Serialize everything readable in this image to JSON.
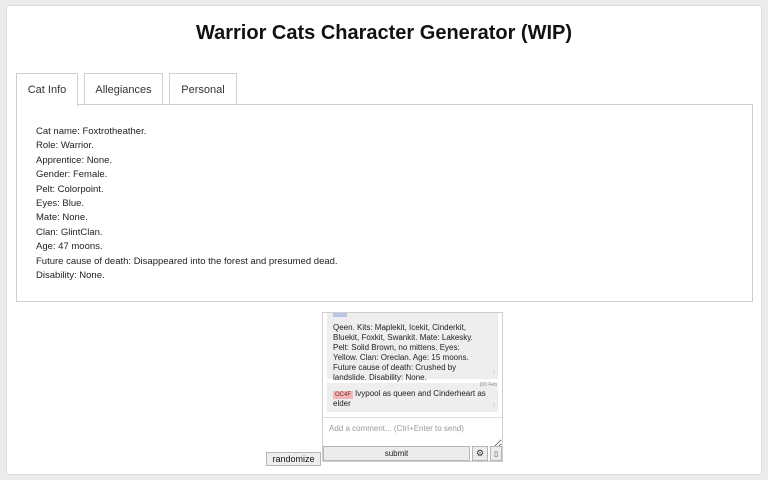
{
  "page": {
    "title": "Warrior Cats Character Generator (WIP)"
  },
  "tabs": [
    {
      "label": "Cat Info",
      "active": true
    },
    {
      "label": "Allegiances",
      "active": false
    },
    {
      "label": "Personal",
      "active": false
    }
  ],
  "cat_info": [
    "Cat name: Foxtrotheather.",
    "Role: Warrior.",
    "Apprentice: None.",
    "Gender: Female.",
    "Pelt: Colorpoint.",
    "Eyes: Blue.",
    "Mate: None.",
    "Clan: GlintClan.",
    "Age: 47 moons.",
    "Future cause of death: Disappeared into the forest and presumed dead.",
    "Disability: None."
  ],
  "chat": {
    "messages": [
      {
        "lines": [
          "Qeen. Kits: Maplekit, Icekit, Cinderkit,",
          "Bluekit, Foxkit, Swankit. Mate: Lakesky.",
          "Pelt: Solid Brown, no mittens. Eyes:",
          "Yellow. Clan: Oreclan. Age: 15 moons.",
          "Future cause of death: Crushed by",
          "landslide. Disability: None."
        ]
      },
      {
        "timestamp": "(00 Feb",
        "tag": "OC4F",
        "text": "Ivypool as queen and Cinderheart as elder"
      }
    ],
    "comment_placeholder": "Add a comment... (Ctrl+Enter to send)",
    "submit_label": "submit",
    "settings_icon": "gear-icon",
    "extra_icon": "lock-icon"
  },
  "randomize_label": "randomize"
}
